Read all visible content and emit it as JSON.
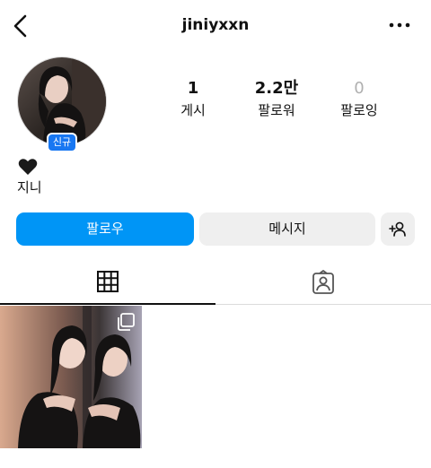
{
  "header": {
    "username": "jiniyxxn",
    "back_icon": "chevron-left-icon",
    "more_icon": "more-horizontal-icon"
  },
  "profile": {
    "new_badge": "신규",
    "bio_emoji": "🖤",
    "display_name": "지니"
  },
  "stats": {
    "posts": {
      "value": "1",
      "label": "게시"
    },
    "followers": {
      "value": "2.2만",
      "label": "팔로워"
    },
    "following": {
      "value": "0",
      "label": "팔로잉"
    }
  },
  "actions": {
    "follow_label": "팔로우",
    "message_label": "메시지",
    "suggest_icon": "add-person-icon"
  },
  "tabs": [
    {
      "icon": "grid-icon",
      "active": true
    },
    {
      "icon": "tagged-person-icon",
      "active": false
    }
  ],
  "colors": {
    "accent": "#0095f6",
    "badge": "#1877f2",
    "secondary_button": "#efefef"
  }
}
